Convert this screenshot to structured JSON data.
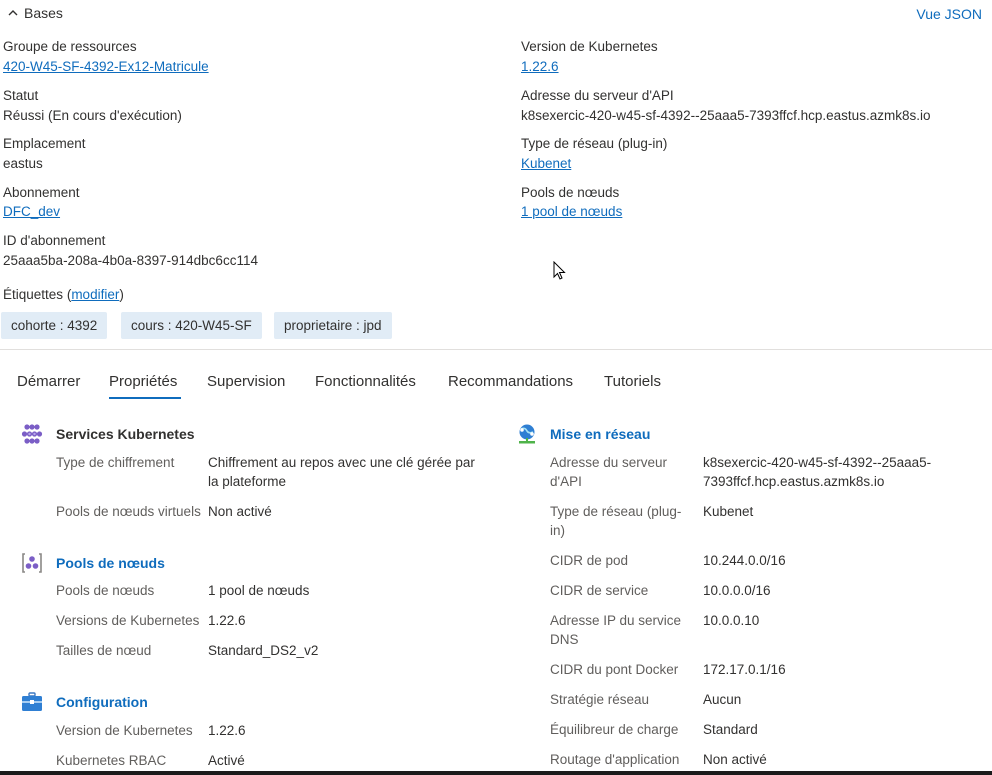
{
  "header": {
    "bases_label": "Bases",
    "vue_json": "Vue JSON"
  },
  "essentials": {
    "left": [
      {
        "label": "Groupe de ressources",
        "value": "420-W45-SF-4392-Ex12-Matricule",
        "link": true
      },
      {
        "label": "Statut",
        "value": "Réussi (En cours d'exécution)",
        "link": false
      },
      {
        "label": "Emplacement",
        "value": "eastus",
        "link": false
      },
      {
        "label": "Abonnement",
        "value": "DFC_dev",
        "link": true
      },
      {
        "label": "ID d'abonnement",
        "value": "25aaa5ba-208a-4b0a-8397-914dbc6cc114",
        "link": false
      }
    ],
    "right": [
      {
        "label": "Version de Kubernetes",
        "value": "1.22.6",
        "link": true
      },
      {
        "label": "Adresse du serveur d'API",
        "value": "k8sexercic-420-w45-sf-4392--25aaa5-7393ffcf.hcp.eastus.azmk8s.io",
        "link": false
      },
      {
        "label": "Type de réseau (plug-in)",
        "value": "Kubenet",
        "link": true
      },
      {
        "label": "Pools de nœuds",
        "value": "1 pool de nœuds",
        "link": true
      }
    ],
    "tags_label": "Étiquettes",
    "tags_paren_open": "(",
    "tags_edit": "modifier",
    "tags_paren_close": ")",
    "tags": [
      "cohorte : 4392",
      "cours : 420-W45-SF",
      "proprietaire : jpd"
    ]
  },
  "tabs": [
    "Démarrer",
    "Propriétés",
    "Supervision",
    "Fonctionnalités",
    "Recommandations",
    "Tutoriels"
  ],
  "active_tab": "Propriétés",
  "services": {
    "title": "Services Kubernetes",
    "rows": [
      {
        "label": "Type de chiffrement",
        "value_line1": "Chiffrement au repos avec une clé gérée par",
        "value_line2": "la plateforme"
      },
      {
        "label": "Pools de nœuds virtuels",
        "value_line1": "Non activé"
      }
    ]
  },
  "node_pools": {
    "title": "Pools de nœuds",
    "rows": [
      {
        "label": "Pools de nœuds",
        "value": "1 pool de nœuds"
      },
      {
        "label": "Versions de Kubernetes",
        "value": "1.22.6"
      },
      {
        "label": "Tailles de nœud",
        "value": "Standard_DS2_v2"
      }
    ]
  },
  "configuration": {
    "title": "Configuration",
    "rows": [
      {
        "label": "Version de Kubernetes",
        "value": "1.22.6"
      },
      {
        "label": "Kubernetes RBAC",
        "value": "Activé"
      }
    ]
  },
  "networking": {
    "title": "Mise en réseau",
    "rows": [
      {
        "label_line1": "Adresse du serveur",
        "label_line2": "d'API",
        "value_line1": "k8sexercic-420-w45-sf-4392--25aaa5-",
        "value_line2": "7393ffcf.hcp.eastus.azmk8s.io"
      },
      {
        "label_line1": "Type de réseau (plug-",
        "label_line2": "in)",
        "value_line1": "Kubenet"
      },
      {
        "label_line1": "CIDR de pod",
        "value_line1": "10.244.0.0/16"
      },
      {
        "label_line1": "CIDR de service",
        "value_line1": "10.0.0.0/16"
      },
      {
        "label_line1": "Adresse IP du service",
        "label_line2": "DNS",
        "value_line1": "10.0.0.10"
      },
      {
        "label_line1": "CIDR du pont Docker",
        "value_line1": "172.17.0.1/16"
      },
      {
        "label_line1": "Stratégie réseau",
        "value_line1": "Aucun"
      },
      {
        "label_line1": "Équilibreur de charge",
        "value_line1": "Standard"
      },
      {
        "label_line1": "Routage d'application",
        "value_line1": "Non activé"
      }
    ]
  },
  "icons": {
    "services": "kubernetes-services-icon",
    "node_pools": "node-pools-icon",
    "configuration": "configuration-icon",
    "networking": "networking-icon",
    "cursor": "mouse-cursor-icon"
  },
  "colors": {
    "link": "#0f6cbd",
    "tag_bg": "#e1ecf6",
    "active_tab_underline": "#0f6cbd"
  }
}
